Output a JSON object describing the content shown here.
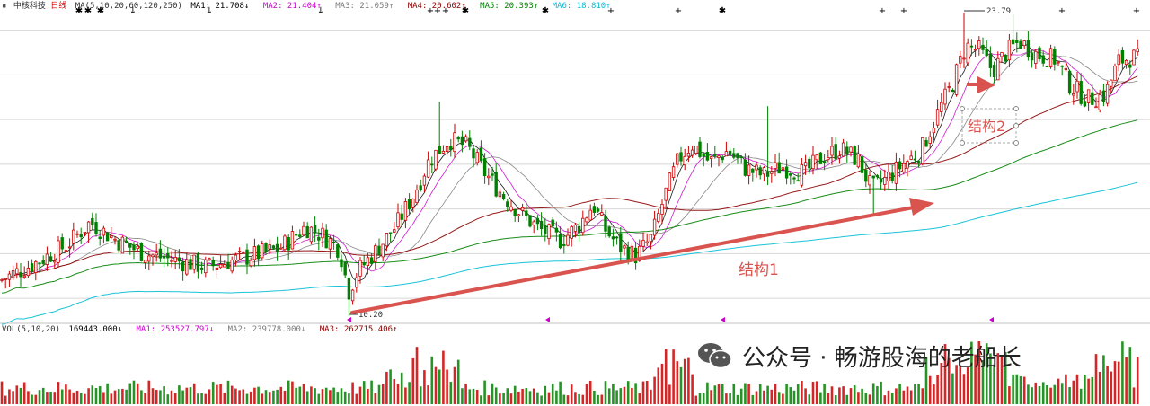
{
  "header": {
    "stock_name": "中核科技",
    "period": "日线",
    "ma_params": "MA(5,10,20,60,120,250)",
    "ma_items": [
      {
        "label": "MA1: 21.708↓",
        "color": "#000000"
      },
      {
        "label": "MA2: 21.404↑",
        "color": "#cc00cc"
      },
      {
        "label": "MA3: 21.059↑",
        "color": "#7a7a7a"
      },
      {
        "label": "MA4: 20.602↑",
        "color": "#8b0000"
      },
      {
        "label": "MA5: 20.393↑",
        "color": "#008000"
      },
      {
        "label": "MA6: 18.810↑",
        "color": "#00bcd4"
      }
    ]
  },
  "volume_header": {
    "params": "VOL(5,10,20)",
    "items": [
      {
        "label": "169443.000↓",
        "color": "#000000"
      },
      {
        "label": "MA1: 253527.797↓",
        "color": "#cc00cc"
      },
      {
        "label": "MA2: 239778.000↓",
        "color": "#7a7a7a"
      },
      {
        "label": "MA3: 262715.406↑",
        "color": "#8b0000"
      }
    ]
  },
  "annotations": {
    "low_price": "10.20",
    "high_price": "23.79",
    "structure1": "结构1",
    "structure2": "结构2"
  },
  "watermark": {
    "text": "公众号 · 畅游股海的老船长",
    "icon": "wechat-icon"
  },
  "chart_data": {
    "type": "candlestick",
    "title": "中核科技 日线",
    "ylim": [
      10.2,
      23.79
    ],
    "grid": true,
    "price_path": [
      {
        "t": 0,
        "p": 11.8
      },
      {
        "t": 40,
        "p": 12.6
      },
      {
        "t": 75,
        "p": 13.4
      },
      {
        "t": 100,
        "p": 14.4
      },
      {
        "t": 130,
        "p": 13.6
      },
      {
        "t": 160,
        "p": 13.0
      },
      {
        "t": 195,
        "p": 12.7
      },
      {
        "t": 230,
        "p": 12.4
      },
      {
        "t": 270,
        "p": 12.8
      },
      {
        "t": 310,
        "p": 13.2
      },
      {
        "t": 340,
        "p": 14.2
      },
      {
        "t": 360,
        "p": 13.8
      },
      {
        "t": 378,
        "p": 13.2
      },
      {
        "t": 388,
        "p": 11.3
      },
      {
        "t": 398,
        "p": 12.2
      },
      {
        "t": 420,
        "p": 13.2
      },
      {
        "t": 440,
        "p": 14.2
      },
      {
        "t": 460,
        "p": 15.6
      },
      {
        "t": 478,
        "p": 17.2
      },
      {
        "t": 500,
        "p": 18.1
      },
      {
        "t": 520,
        "p": 17.8
      },
      {
        "t": 540,
        "p": 16.6
      },
      {
        "t": 560,
        "p": 15.6
      },
      {
        "t": 580,
        "p": 14.8
      },
      {
        "t": 600,
        "p": 14.1
      },
      {
        "t": 625,
        "p": 13.6
      },
      {
        "t": 645,
        "p": 14.3
      },
      {
        "t": 660,
        "p": 15.2
      },
      {
        "t": 675,
        "p": 14.0
      },
      {
        "t": 690,
        "p": 13.3
      },
      {
        "t": 708,
        "p": 12.9
      },
      {
        "t": 725,
        "p": 13.7
      },
      {
        "t": 740,
        "p": 15.6
      },
      {
        "t": 755,
        "p": 17.2
      },
      {
        "t": 770,
        "p": 17.9
      },
      {
        "t": 790,
        "p": 17.1
      },
      {
        "t": 810,
        "p": 17.6
      },
      {
        "t": 830,
        "p": 16.8
      },
      {
        "t": 850,
        "p": 16.5
      },
      {
        "t": 870,
        "p": 16.9
      },
      {
        "t": 895,
        "p": 16.6
      },
      {
        "t": 915,
        "p": 17.3
      },
      {
        "t": 935,
        "p": 17.7
      },
      {
        "t": 955,
        "p": 17.2
      },
      {
        "t": 970,
        "p": 15.9
      },
      {
        "t": 985,
        "p": 16.3
      },
      {
        "t": 1005,
        "p": 17.0
      },
      {
        "t": 1025,
        "p": 17.6
      },
      {
        "t": 1045,
        "p": 19.4
      },
      {
        "t": 1060,
        "p": 20.6
      },
      {
        "t": 1075,
        "p": 22.3
      },
      {
        "t": 1090,
        "p": 22.1
      },
      {
        "t": 1105,
        "p": 21.2
      },
      {
        "t": 1120,
        "p": 22.0
      },
      {
        "t": 1135,
        "p": 22.5
      },
      {
        "t": 1155,
        "p": 21.9
      },
      {
        "t": 1175,
        "p": 21.7
      },
      {
        "t": 1190,
        "p": 20.6
      },
      {
        "t": 1210,
        "p": 19.9
      },
      {
        "t": 1230,
        "p": 20.1
      },
      {
        "t": 1245,
        "p": 21.6
      },
      {
        "t": 1260,
        "p": 21.8
      },
      {
        "t": 1270,
        "p": 21.7
      }
    ],
    "ma_lines": [
      {
        "name": "MA1",
        "color": "#000000",
        "window": 5
      },
      {
        "name": "MA2",
        "color": "#cc00cc",
        "window": 10
      },
      {
        "name": "MA3",
        "color": "#7a7a7a",
        "window": 20
      },
      {
        "name": "MA4",
        "color": "#8b0000",
        "window": 60
      },
      {
        "name": "MA5",
        "color": "#008000",
        "window": 120
      },
      {
        "name": "MA6",
        "color": "#00bcd4",
        "window": 250
      }
    ],
    "colors": {
      "up": "#cc0000",
      "down": "#008000",
      "grid": "#d8d8d8",
      "arrow": "#d9534f",
      "signal": "#cc00cc"
    }
  }
}
